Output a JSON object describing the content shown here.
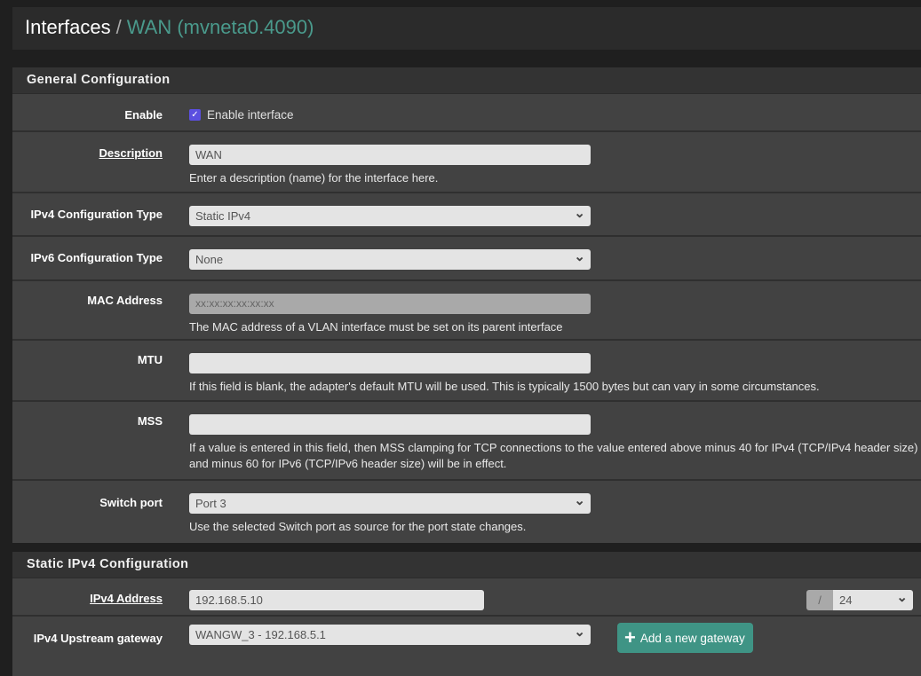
{
  "header": {
    "section": "Interfaces",
    "separator": "/",
    "title": "WAN (mvneta0.4090)"
  },
  "general": {
    "heading": "General Configuration",
    "enable": {
      "label": "Enable",
      "checkbox_label": "Enable interface",
      "checked": true
    },
    "description": {
      "label": "Description",
      "value": "WAN",
      "help": "Enter a description (name) for the interface here."
    },
    "ipv4_type": {
      "label": "IPv4 Configuration Type",
      "value": "Static IPv4"
    },
    "ipv6_type": {
      "label": "IPv6 Configuration Type",
      "value": "None"
    },
    "mac": {
      "label": "MAC Address",
      "placeholder": "xx:xx:xx:xx:xx:xx",
      "help": "The MAC address of a VLAN interface must be set on its parent interface"
    },
    "mtu": {
      "label": "MTU",
      "value": "",
      "help": "If this field is blank, the adapter's default MTU will be used. This is typically 1500 bytes but can vary in some circumstances."
    },
    "mss": {
      "label": "MSS",
      "value": "",
      "help": "If a value is entered in this field, then MSS clamping for TCP connections to the value entered above minus 40 for IPv4 (TCP/IPv4 header size) and minus 60 for IPv6 (TCP/IPv6 header size) will be in effect."
    },
    "switch_port": {
      "label": "Switch port",
      "value": "Port 3",
      "help": "Use the selected Switch port as source for the port state changes."
    }
  },
  "static": {
    "heading": "Static IPv4 Configuration",
    "address": {
      "label": "IPv4 Address",
      "value": "192.168.5.10",
      "slash": "/",
      "cidr": "24"
    },
    "gateway": {
      "label": "IPv4 Upstream gateway",
      "value": "WANGW_3 - 192.168.5.1",
      "add_button": "Add a new gateway"
    }
  },
  "colors": {
    "accent": "#4a9a8c",
    "button": "#3f9485",
    "checkbox": "#5b4fe0"
  }
}
